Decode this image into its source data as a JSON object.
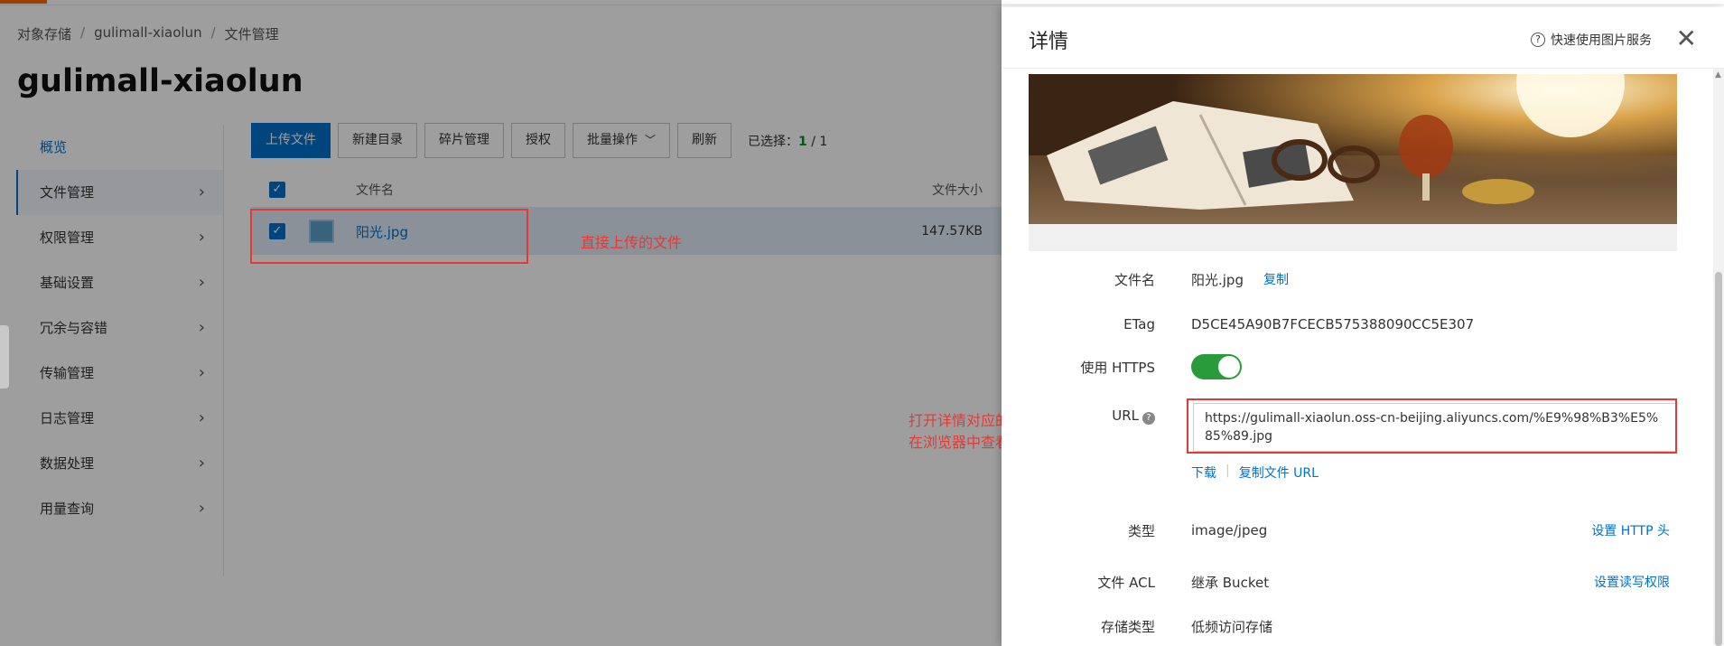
{
  "breadcrumb": [
    "对象存储",
    "gulimall-xiaolun",
    "文件管理"
  ],
  "breadcrumb_sep": "/",
  "bucket_title": "gulimall-xiaolun",
  "sidebar": {
    "items": [
      {
        "label": "概览"
      },
      {
        "label": "文件管理"
      },
      {
        "label": "权限管理"
      },
      {
        "label": "基础设置"
      },
      {
        "label": "冗余与容错"
      },
      {
        "label": "传输管理"
      },
      {
        "label": "日志管理"
      },
      {
        "label": "数据处理"
      },
      {
        "label": "用量查询"
      }
    ]
  },
  "toolbar": {
    "upload": "上传文件",
    "new_dir": "新建目录",
    "fragments": "碎片管理",
    "authorize": "授权",
    "batch": "批量操作",
    "refresh": "刷新",
    "selected_label": "已选择：",
    "selected_count": "1",
    "selected_sep": " / ",
    "selected_total": "1"
  },
  "table": {
    "col_name": "文件名",
    "col_size": "文件大小",
    "rows": [
      {
        "name": "阳光.jpg",
        "size": "147.57KB"
      }
    ]
  },
  "annotations": {
    "uploaded": "直接上传的文件",
    "url_line1": "打开详情对应的URL地址。",
    "url_line2": "在浏览器中查看该地址，会下载下来"
  },
  "drawer": {
    "title": "详情",
    "help": "快速使用图片服务",
    "filename_label": "文件名",
    "filename": "阳光.jpg",
    "copy": "复制",
    "etag_label": "ETag",
    "etag": "D5CE45A90B7FCECB575388090CC5E307",
    "https_label": "使用 HTTPS",
    "https_enabled": true,
    "url_label": "URL",
    "url": "https://gulimall-xiaolun.oss-cn-beijing.aliyuncs.com/%E9%98%B3%E5%85%89.jpg",
    "download": "下载",
    "copy_url": "复制文件 URL",
    "type_label": "类型",
    "type": "image/jpeg",
    "set_http_header": "设置 HTTP 头",
    "acl_label": "文件 ACL",
    "acl": "继承 Bucket",
    "set_acl": "设置读写权限",
    "storage_label": "存储类型",
    "storage": "低频访问存储"
  },
  "colors": {
    "primary": "#0070cc",
    "accent": "#ff6a00",
    "annotation": "#e53935",
    "toggle_on": "#2a9b3b"
  }
}
